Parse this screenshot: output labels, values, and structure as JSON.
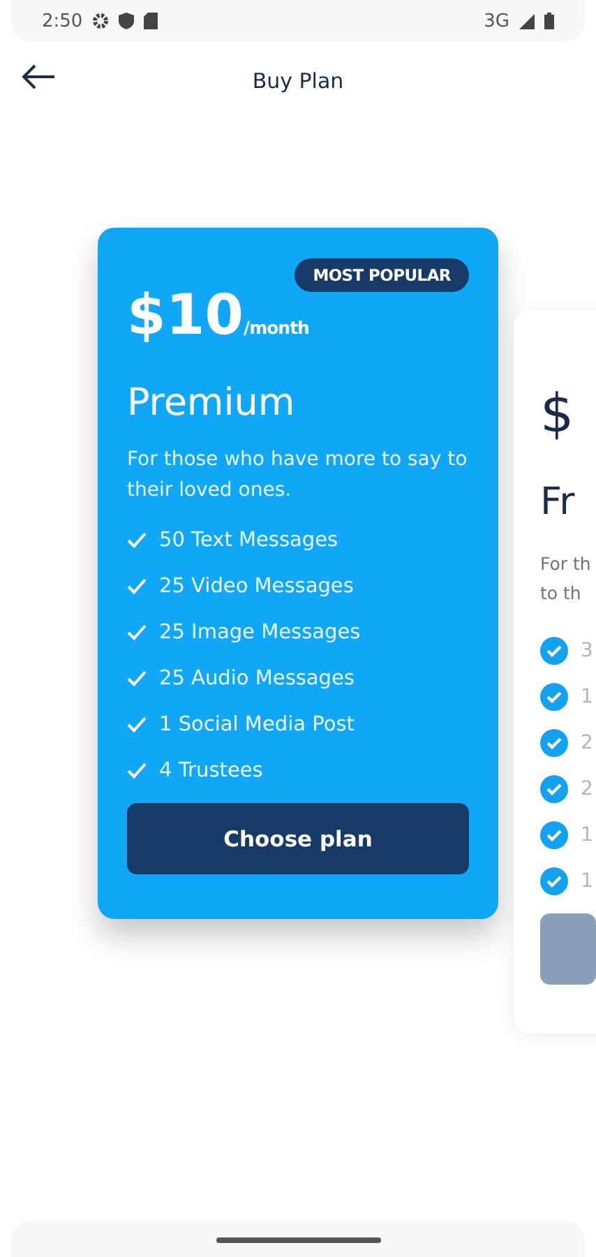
{
  "status_bar": {
    "time": "2:50",
    "network": "3G"
  },
  "header": {
    "title": "Buy Plan"
  },
  "plans": [
    {
      "kind": "featured",
      "badge": "MOST POPULAR",
      "price": "$10",
      "period": "/month",
      "name": "Premium",
      "description": [
        "For those who have more to say to their loved ones."
      ],
      "features": [
        "50 Text Messages",
        "25 Video Messages",
        "25 Image Messages",
        "25 Audio Messages",
        "1 Social Media Post",
        "4 Trustees"
      ],
      "button": "Choose plan"
    },
    {
      "kind": "basic",
      "price": "$",
      "name": "Fr",
      "description": [
        "For th",
        "to th"
      ],
      "features": [
        "3",
        "1",
        "2",
        "2",
        "1",
        "1"
      ]
    }
  ]
}
